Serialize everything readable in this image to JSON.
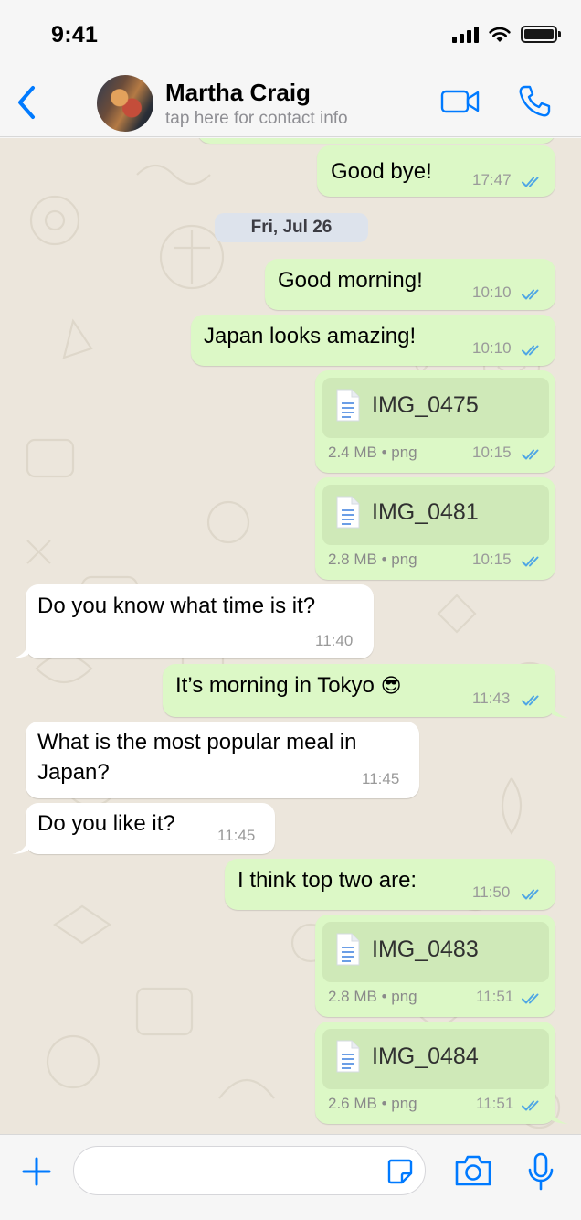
{
  "status_bar": {
    "time": "9:41"
  },
  "header": {
    "contact_name": "Martha Craig",
    "contact_subtitle": "tap here for contact info",
    "back_icon": "chevron-left-icon",
    "video_icon": "video-camera-icon",
    "call_icon": "phone-icon"
  },
  "colors": {
    "accent": "#007aff",
    "outgoing_bubble": "#dcf8c6",
    "incoming_bubble": "#ffffff",
    "chat_background": "#ece6dc",
    "read_ticks": "#4fa6e4"
  },
  "chat": {
    "date_separator": "Fri, Jul 26",
    "messages": [
      {
        "direction": "outgoing",
        "kind": "text",
        "text": "Good bye!",
        "time": "17:47",
        "status": "read"
      },
      {
        "direction": "outgoing",
        "kind": "text",
        "text": "Good morning!",
        "time": "10:10",
        "status": "read"
      },
      {
        "direction": "outgoing",
        "kind": "text",
        "text": "Japan looks amazing!",
        "time": "10:10",
        "status": "read"
      },
      {
        "direction": "outgoing",
        "kind": "file",
        "file_name": "IMG_0475",
        "size": "2.4 MB",
        "file_type": "png",
        "time": "10:15",
        "status": "read"
      },
      {
        "direction": "outgoing",
        "kind": "file",
        "file_name": "IMG_0481",
        "size": "2.8 MB",
        "file_type": "png",
        "time": "10:15",
        "status": "read"
      },
      {
        "direction": "incoming",
        "kind": "text",
        "text": "Do you know what time is it?",
        "time": "11:40"
      },
      {
        "direction": "outgoing",
        "kind": "text",
        "text": "It’s morning in Tokyo",
        "emoji": "😎",
        "time": "11:43",
        "status": "read"
      },
      {
        "direction": "incoming",
        "kind": "text",
        "text_lines": [
          "What is the most popular meal in",
          "Japan?"
        ],
        "time": "11:45"
      },
      {
        "direction": "incoming",
        "kind": "text",
        "text": "Do you like it?",
        "time": "11:45"
      },
      {
        "direction": "outgoing",
        "kind": "text",
        "text": "I think top two are:",
        "time": "11:50",
        "status": "read"
      },
      {
        "direction": "outgoing",
        "kind": "file",
        "file_name": "IMG_0483",
        "size": "2.8 MB",
        "file_type": "png",
        "time": "11:51",
        "status": "read"
      },
      {
        "direction": "outgoing",
        "kind": "file",
        "file_name": "IMG_0484",
        "size": "2.6 MB",
        "file_type": "png",
        "time": "11:51",
        "status": "read"
      }
    ]
  },
  "composer": {
    "input_value": "",
    "placeholder": "",
    "plus_icon": "plus-icon",
    "sticker_icon": "sticker-icon",
    "camera_icon": "camera-icon",
    "mic_icon": "microphone-icon"
  }
}
